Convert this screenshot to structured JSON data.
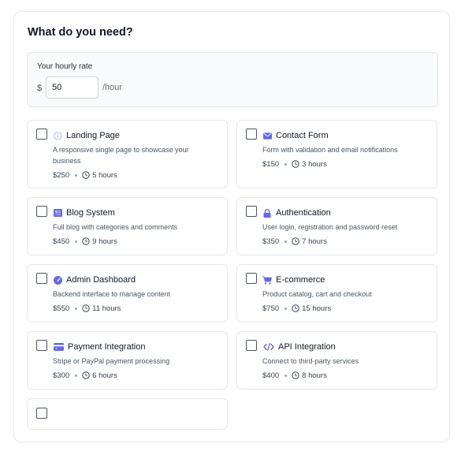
{
  "section": {
    "title": "What do you need?"
  },
  "rate": {
    "label": "Your hourly rate",
    "currency": "$",
    "value": "50",
    "unit": "/hour"
  },
  "colors": {
    "accent": "#6366f1",
    "border": "#e5e7eb",
    "muted_icon": "#a5b4fc"
  },
  "services": [
    {
      "title": "Landing Page",
      "description": "A responsive single page to showcase your business",
      "price": "$250",
      "duration": "5 hours",
      "icon": "info-circle-icon",
      "checked": false
    },
    {
      "title": "Contact Form",
      "description": "Form with validation and email notifications",
      "price": "$150",
      "duration": "3 hours",
      "icon": "envelope-icon",
      "checked": false
    },
    {
      "title": "Blog System",
      "description": "Full blog with categories and comments",
      "price": "$450",
      "duration": "9 hours",
      "icon": "blog-icon",
      "checked": false
    },
    {
      "title": "Authentication",
      "description": "User login, registration and password reset",
      "price": "$350",
      "duration": "7 hours",
      "icon": "lock-icon",
      "checked": false
    },
    {
      "title": "Admin Dashboard",
      "description": "Backend interface to manage content",
      "price": "$550",
      "duration": "11 hours",
      "icon": "gauge-icon",
      "checked": false
    },
    {
      "title": "E-commerce",
      "description": "Product catalog, cart and checkout",
      "price": "$750",
      "duration": "15 hours",
      "icon": "cart-icon",
      "checked": false
    },
    {
      "title": "Payment Integration",
      "description": "Stripe or PayPal payment processing",
      "price": "$300",
      "duration": "6 hours",
      "icon": "credit-card-icon",
      "checked": false
    },
    {
      "title": "API Integration",
      "description": "Connect to third-party services",
      "price": "$400",
      "duration": "8 hours",
      "icon": "code-icon",
      "checked": false
    },
    {
      "checked": false
    }
  ]
}
